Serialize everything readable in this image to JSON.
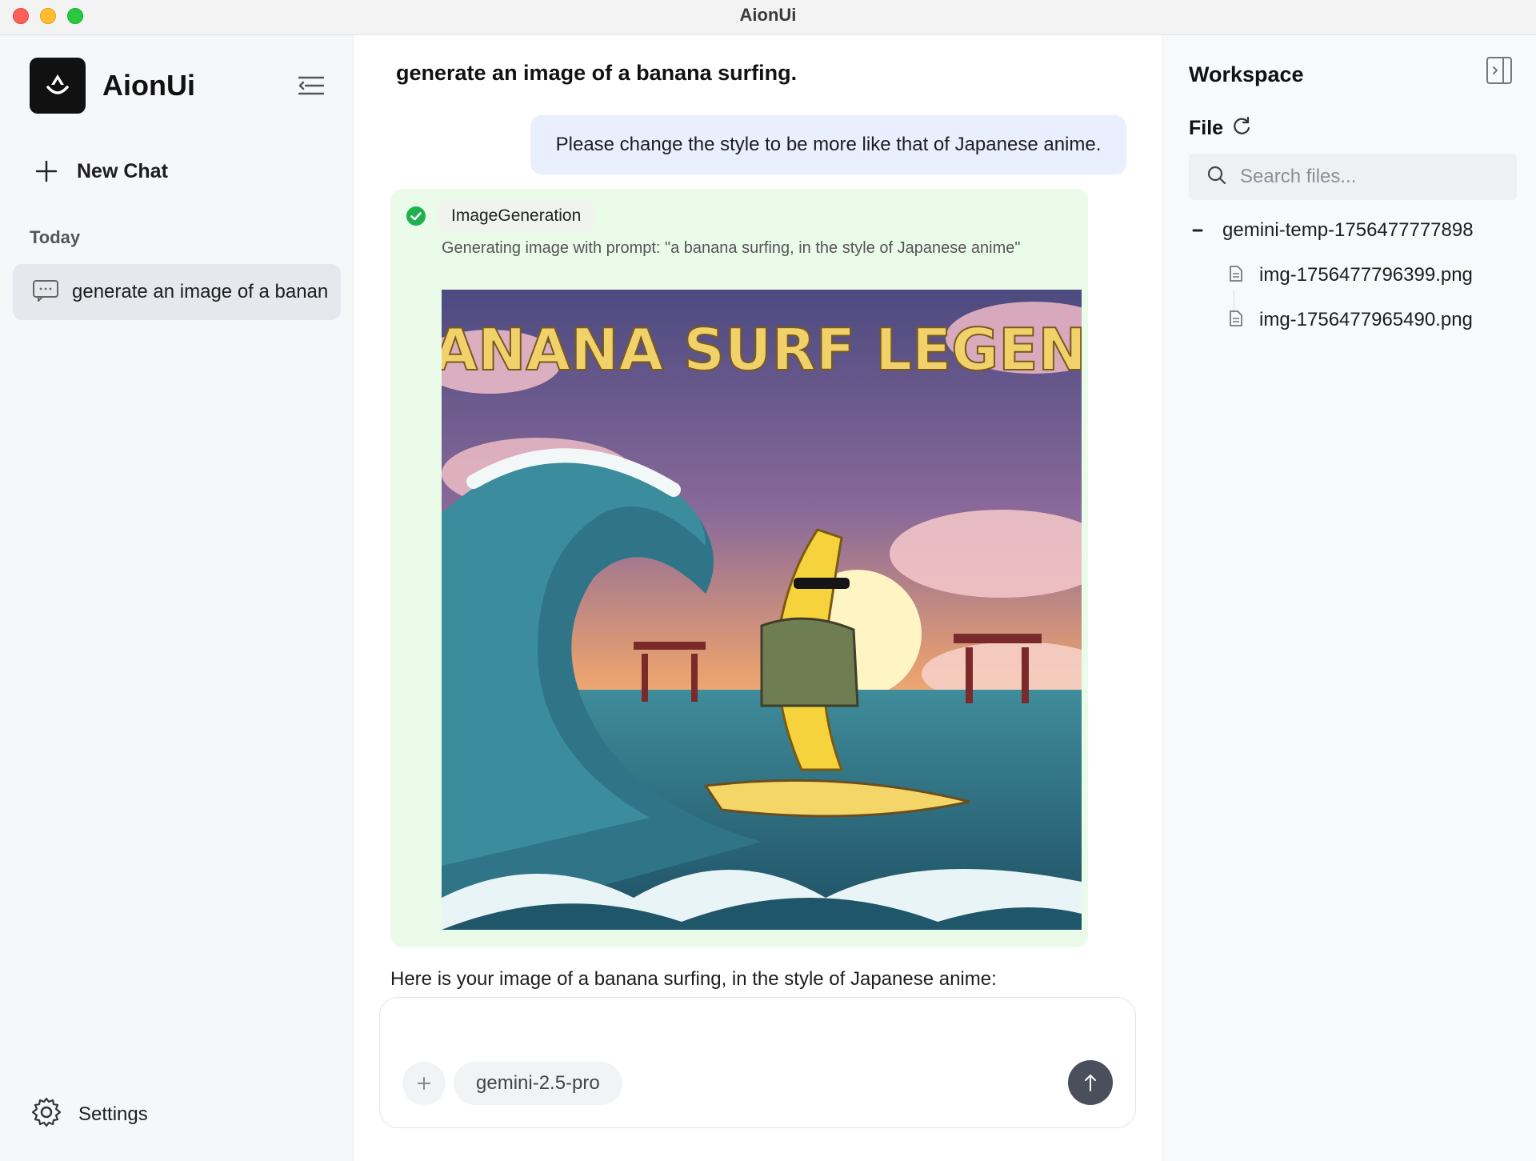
{
  "window": {
    "title": "AionUi"
  },
  "sidebar": {
    "brand": "AionUi",
    "new_chat_label": "New Chat",
    "section_today": "Today",
    "chats": [
      {
        "label": "generate an image of a banana surfing."
      }
    ],
    "settings_label": "Settings"
  },
  "main": {
    "title": "generate an image of a banana surfing.",
    "user_message": "Please change the style to be more like that of Japanese anime.",
    "tool": {
      "name": "ImageGeneration",
      "status": "success",
      "description": "Generating image with prompt: \"a banana surfing, in the style of Japanese anime\"",
      "image_caption": "BANANA SURF LEGEND"
    },
    "assistant_reply": "Here is your image of a banana surfing, in the style of Japanese anime:",
    "composer": {
      "model": "gemini-2.5-pro"
    }
  },
  "workspace": {
    "title": "Workspace",
    "file_label": "File",
    "search_placeholder": "Search files...",
    "folder": "gemini-temp-1756477777898",
    "files": [
      "img-1756477796399.png",
      "img-1756477965490.png"
    ]
  },
  "colors": {
    "accent_green": "#1fb14e",
    "tool_card_bg": "#eafbea",
    "user_bubble_bg": "#e9efff",
    "send_button": "#49505c"
  }
}
